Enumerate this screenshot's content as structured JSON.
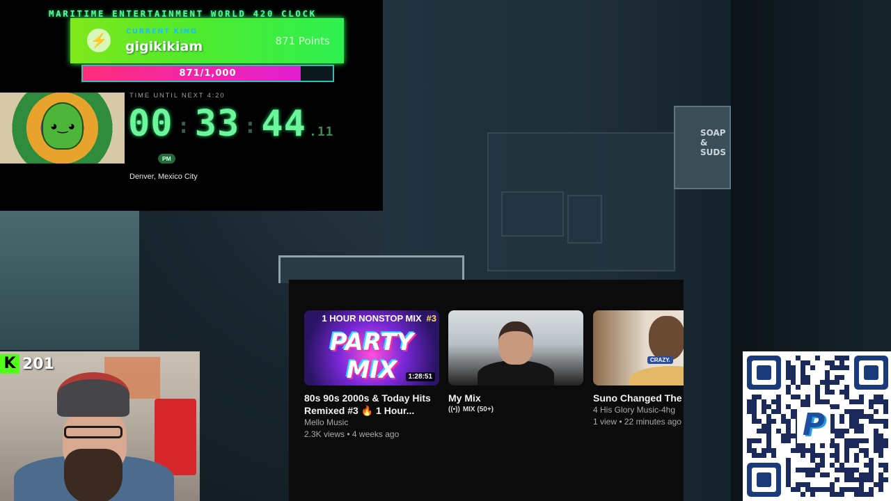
{
  "clock": {
    "title": "MARITIME ENTERTAINMENT WORLD 420 CLOCK",
    "king_label": "CURRENT KING",
    "king_name": "gigikikiam",
    "king_points": "871 Points",
    "progress_text": "871/1,000",
    "progress_value": 871,
    "progress_max": 1000,
    "time_label": "TIME UNTIL NEXT 4:20",
    "hours": "00",
    "minutes": "33",
    "seconds": "44",
    "fraction": ".11",
    "period": "PM",
    "location": "Denver, Mexico City",
    "accent_color": "#6cf59a"
  },
  "youtube": {
    "cards": [
      {
        "thumb_header": "1 HOUR NONSTOP MIX",
        "thumb_number": "#3",
        "thumb_text": "PARTY MIX",
        "duration": "1:28:51",
        "title": "80s 90s 2000s & Today Hits Remixed #3 🔥 1 Hour...",
        "channel": "Mello Music",
        "stats": "2.3K views • 4 weeks ago"
      },
      {
        "title": "My Mix",
        "mix_label": "MIX (50+)"
      },
      {
        "thumb_badge": "CRAZY.",
        "title": "Suno Changed The G",
        "channel": "4 His Glory Music-4hg",
        "stats": "1 view • 22 minutes ago"
      }
    ]
  },
  "stream": {
    "kick_logo": "K",
    "viewer_count": "201"
  },
  "background": {
    "sign_text": "SOAP & SUDS"
  }
}
